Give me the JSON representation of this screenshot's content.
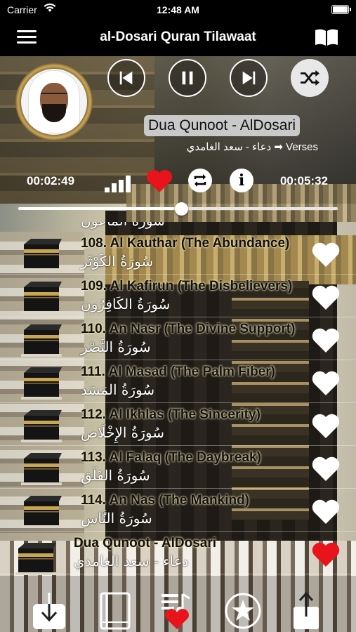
{
  "status_bar": {
    "carrier": "Carrier",
    "time": "12:48 AM"
  },
  "nav": {
    "title": "al-Dosari Quran Tilawaat",
    "menu_icon": "hamburger-menu-icon",
    "book_icon": "book-icon"
  },
  "player": {
    "controls": [
      "previous-icon",
      "pause-icon",
      "next-icon",
      "shuffle-icon"
    ],
    "track_title": "Dua Qunoot - AlDosari",
    "track_subtitle": "Verses ➡ دعاء - سعد الغامدي",
    "elapsed": "00:02:49",
    "duration": "00:05:32",
    "progress": 0.51,
    "favorite": true,
    "colors": {
      "heart": "#e8131b",
      "text_highlight": "#c9c9c9"
    }
  },
  "list": {
    "partial_top": "سُورَةُ الماعون",
    "items": [
      {
        "en": "108. Al Kauthar (The Abundance)",
        "ar": "سُورَةُ الكَوْثَر",
        "fav": false
      },
      {
        "en": "109. Al Kafirun (The Disbelievers)",
        "ar": "سُورَةُ الكَافِرُون",
        "fav": false
      },
      {
        "en": "110. An Nasr (The Divine Support)",
        "ar": "سُورَةُ النَّصْر",
        "fav": false
      },
      {
        "en": "111. Al Masad (The Palm Fiber)",
        "ar": "سُورَةُ المَسَد",
        "fav": false
      },
      {
        "en": "112. Al Ikhlas (The Sincerity)",
        "ar": "سُورَةُ الإِخْلَاص",
        "fav": false
      },
      {
        "en": "113. Al Falaq (The Daybreak)",
        "ar": "سُورَةُ الفَلَق",
        "fav": false
      },
      {
        "en": "114. An Nas (The Mankind)",
        "ar": "سُورَةُ النَّاس",
        "fav": false
      },
      {
        "en": "Dua Qunoot - AlDosari",
        "ar": "دعاء - سعد الغامدي",
        "fav": true
      }
    ]
  },
  "tabbar": {
    "tabs": [
      "download-icon",
      "book-icon",
      "playlist-favorites-icon",
      "star-icon",
      "share-icon"
    ]
  }
}
